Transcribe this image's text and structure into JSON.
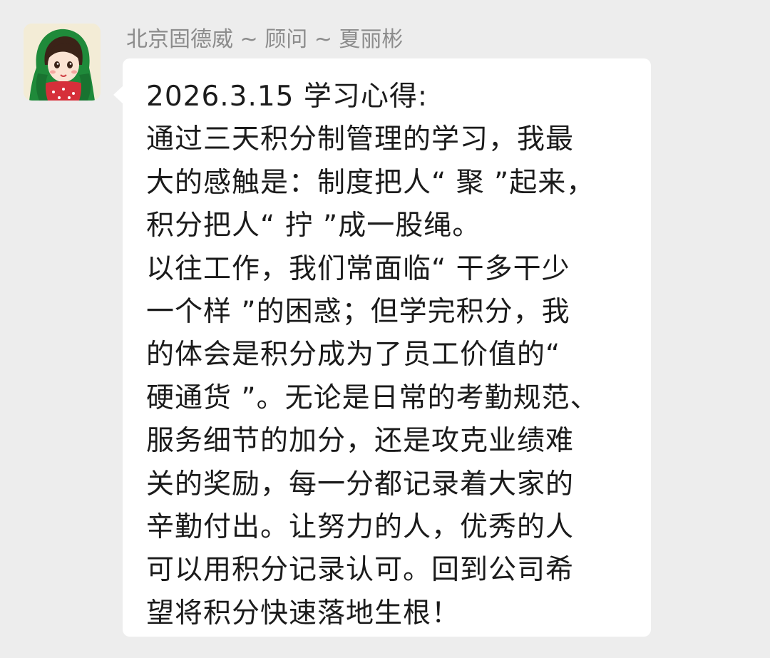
{
  "sender": {
    "name": "北京固德威 ~ 顾问 ~ 夏丽彬",
    "avatar_icon": "cartoon-girl-red-scarf-avatar"
  },
  "message": {
    "text": "2026.3.15 学习心得:\n通过三天积分制管理的学习，我最\n大的感触是：制度把人“ 聚 ”起来，\n积分把人“ 拧 ”成一股绳。\n以往工作，我们常面临“ 干多干少\n一个样 ”的困惑；但学完积分，我\n的体会是积分成为了员工价值的“\n硬通货 ”。无论是日常的考勤规范、\n服务细节的加分，还是攻克业绩难\n关的奖励，每一分都记录着大家的\n辛勤付出。让努力的人，优秀的人\n可以用积分记录认可。回到公司希\n望将积分快速落地生根！"
  },
  "colors": {
    "background": "#ededed",
    "bubble": "#ffffff",
    "text": "#1b1b1b",
    "sender_name": "#8c8c8c"
  }
}
